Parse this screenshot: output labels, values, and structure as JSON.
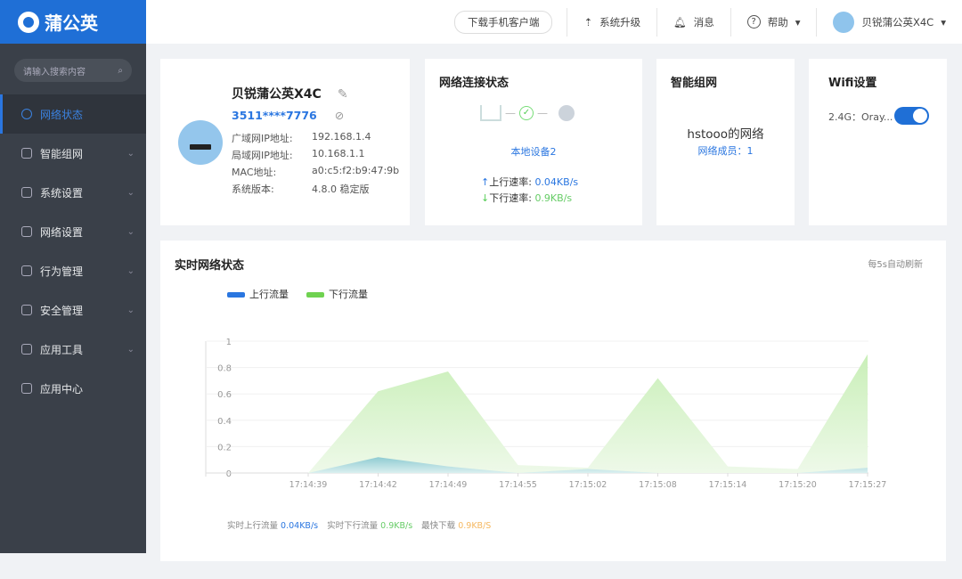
{
  "app": {
    "logo": "蒲公英",
    "search_placeholder": "请输入搜索内容"
  },
  "sidebar": {
    "items": [
      {
        "label": "网络状态",
        "active": true
      },
      {
        "label": "智能组网"
      },
      {
        "label": "系统设置"
      },
      {
        "label": "网络设置"
      },
      {
        "label": "行为管理"
      },
      {
        "label": "安全管理"
      },
      {
        "label": "应用工具"
      },
      {
        "label": "应用中心"
      }
    ]
  },
  "topbar": {
    "download": "下载手机客户端",
    "upgrade": "系统升级",
    "messages": "消息",
    "help": "帮助",
    "device": "贝锐蒲公英X4C"
  },
  "device": {
    "name": "贝锐蒲公英X4C",
    "sn": "3511****7776",
    "wan_label": "广域网IP地址:",
    "wan": "192.168.1.4",
    "lan_label": "局域网IP地址:",
    "lan": "10.168.1.1",
    "mac_label": "MAC地址:",
    "mac": "a0:c5:f2:b9:47:9b",
    "ver_label": "系统版本:",
    "ver": "4.8.0 稳定版"
  },
  "conn": {
    "title": "网络连接状态",
    "local": "本地设备2",
    "up_label": "上行速率:",
    "up": "0.04KB/s",
    "down_label": "下行速率:",
    "down": "0.9KB/s"
  },
  "mesh": {
    "title": "智能组网",
    "network": "hstooo的网络",
    "members": "网络成员：1"
  },
  "wifi": {
    "title": "Wifi设置",
    "band": "2.4G：Oray...",
    "enabled": true
  },
  "realtime": {
    "title": "实时网络状态",
    "refresh": "每5s自动刷新",
    "up_label": "实时上行流量",
    "up": "0.04KB/s",
    "down_label": "实时下行流量",
    "down": "0.9KB/s",
    "max_label": "最快下载",
    "max": "0.9KB/S"
  },
  "chart_data": {
    "type": "area",
    "categories": [
      "17:14:39",
      "17:14:42",
      "17:14:49",
      "17:14:55",
      "17:15:02",
      "17:15:08",
      "17:15:14",
      "17:15:20",
      "17:15:27"
    ],
    "series": [
      {
        "name": "上行流量",
        "color": "#2a76e0",
        "values": [
          0,
          0.12,
          0.05,
          0,
          0.03,
          0,
          0,
          0,
          0.04
        ]
      },
      {
        "name": "下行流量",
        "color": "#6fd250",
        "values": [
          0,
          0.62,
          0.77,
          0.06,
          0.04,
          0.72,
          0.05,
          0.03,
          0.9
        ]
      }
    ],
    "ylim": [
      0,
      1
    ],
    "yticks": [
      "0",
      "0.2",
      "0.4",
      "0.6",
      "0.8",
      "1"
    ],
    "legend": "top-left",
    "grid": true
  }
}
